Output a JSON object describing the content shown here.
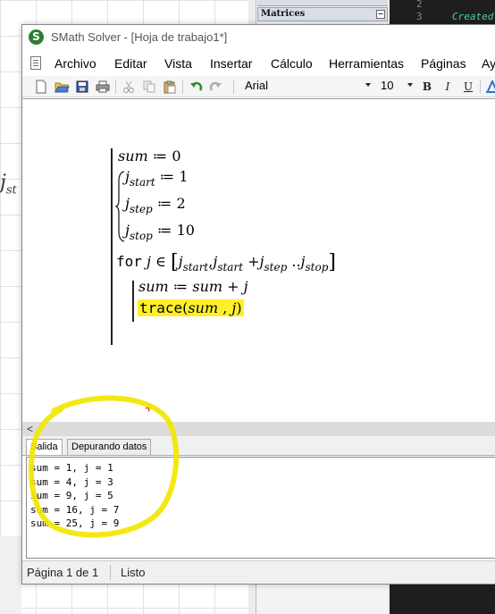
{
  "background": {
    "left_glyph": "j",
    "left_glyph_sub": "st",
    "panel_header": "Matrices",
    "panel_header_btn": "−",
    "code_lines": [
      "2",
      "3"
    ],
    "code_keyword": "Created"
  },
  "window": {
    "title": "SMath Solver - [Hoja de trabajo1*]",
    "app_icon_letter": "S"
  },
  "menu": {
    "items": [
      "Archivo",
      "Editar",
      "Vista",
      "Insertar",
      "Cálculo",
      "Herramientas",
      "Páginas",
      "Ay"
    ]
  },
  "toolbar": {
    "font": "Arial",
    "size": "10",
    "bold": "B",
    "italic": "I",
    "underline": "U",
    "icons": [
      "new-document-icon",
      "open-folder-icon",
      "save-icon",
      "print-icon",
      "cut-icon",
      "copy-icon",
      "paste-icon",
      "undo-icon",
      "redo-icon"
    ]
  },
  "sheet": {
    "line_sum": {
      "var": "sum",
      "op": " ≔ ",
      "val": "0"
    },
    "jstart": {
      "var": "j",
      "sub": "start",
      "op": " ≔ ",
      "val": "1"
    },
    "jstep": {
      "var": "j",
      "sub": "step",
      "op": " ≔ ",
      "val": "2"
    },
    "jstop": {
      "var": "j",
      "sub": "stop",
      "op": " ≔ ",
      "val": "10"
    },
    "for_kw": "for",
    "for_var": "j",
    "in_sym": "∈",
    "range": {
      "open": "[",
      "j": "j",
      "s1": "start",
      "comma": ",",
      "s2": "start",
      "plus": "+",
      "s3": "step",
      "dots": "..",
      "s4": "stop",
      "close": "]"
    },
    "body_sum": {
      "lhs": "sum",
      "op": " ≔ ",
      "rhs1": "sum",
      "plus": " + ",
      "rhs2": "j"
    },
    "trace": {
      "fn": "trace",
      "open": "(",
      "a1": "sum",
      "comma": " , ",
      "a2": "j",
      "close": ")"
    },
    "cursor": "+"
  },
  "hscroll": {
    "left_arrow": "<"
  },
  "tabs": [
    "Salida",
    "Depurando datos"
  ],
  "output": {
    "lines": [
      "sum = 1, j = 1",
      "sum = 4, j = 3",
      "sum = 9, j = 5",
      "sum = 16, j = 7",
      "sum = 25, j = 9"
    ]
  },
  "status": {
    "page": "Página 1 de 1",
    "state": "Listo"
  },
  "colors": {
    "highlight": "#ffef2a",
    "annotation_circle": "#f2e600",
    "cursor": "#e02020",
    "app_icon": "#2e7d32"
  }
}
